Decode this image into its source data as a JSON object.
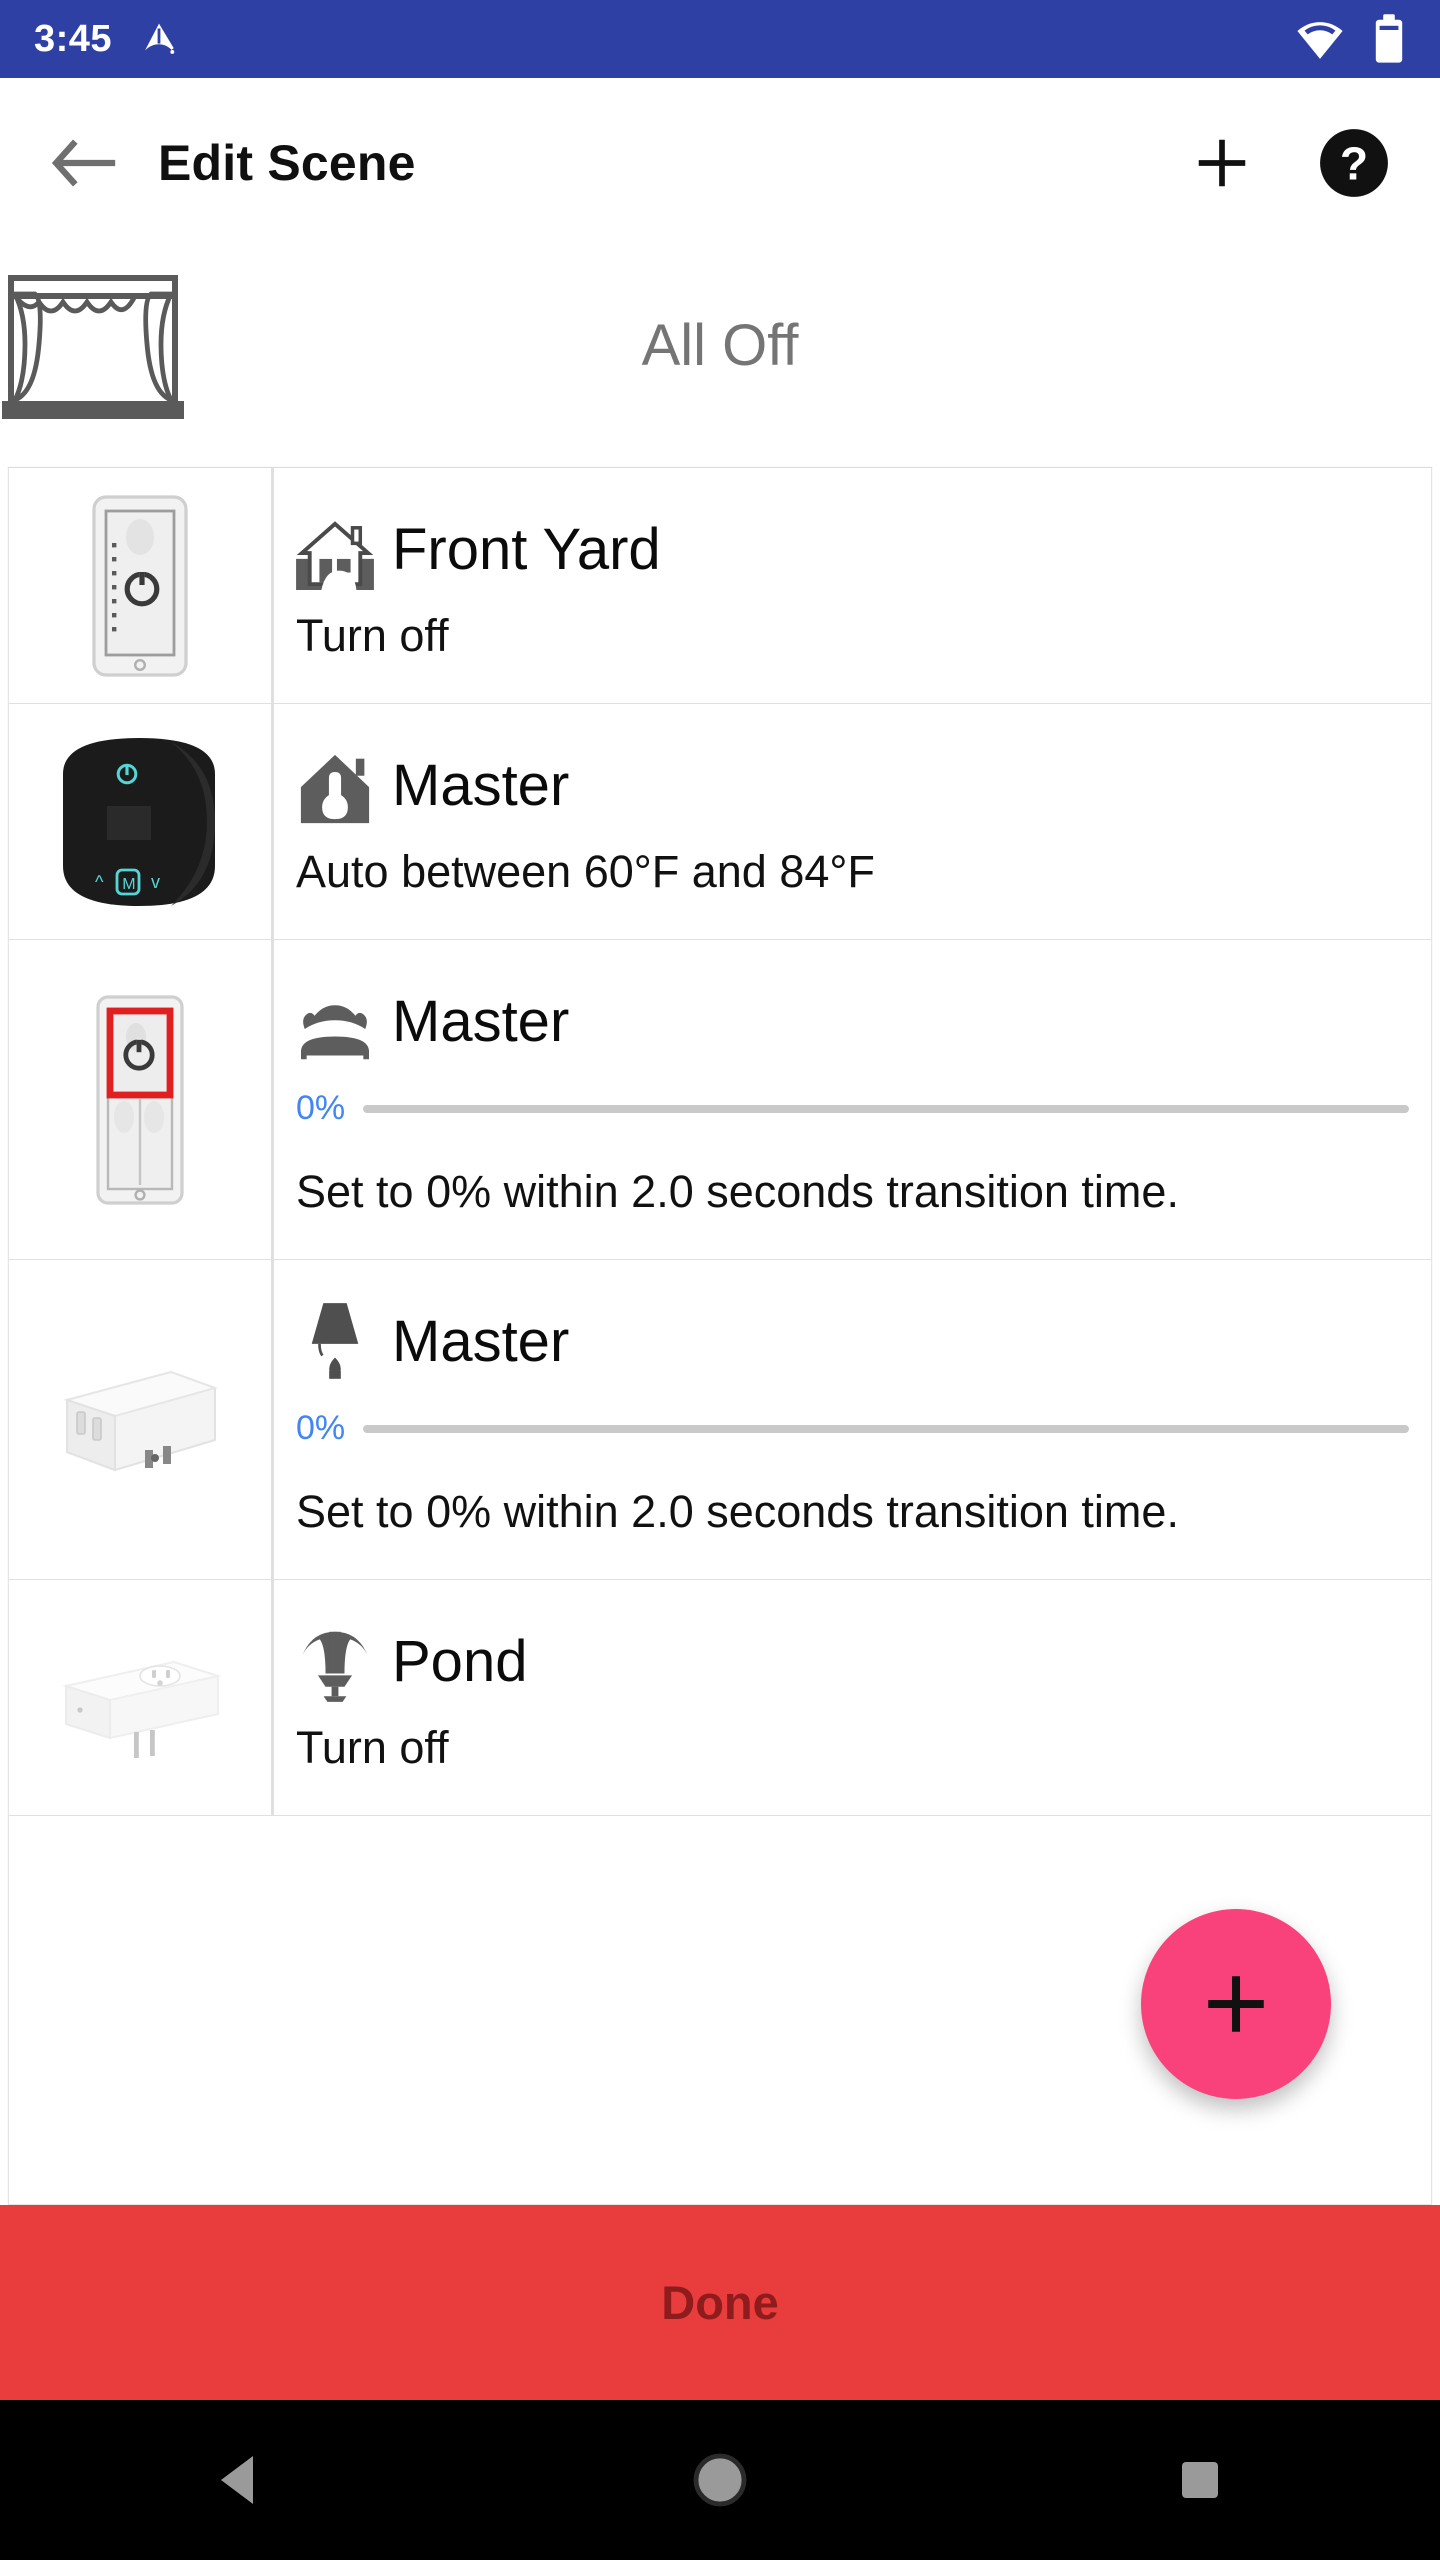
{
  "status_bar": {
    "time": "3:45",
    "icons": [
      "app-notification-icon",
      "wifi-icon",
      "battery-icon"
    ],
    "background": "#2F40A5"
  },
  "app_bar": {
    "back_icon": "back-arrow-icon",
    "title": "Edit Scene",
    "add_icon": "plus-icon",
    "help_icon": "help-circle-icon"
  },
  "scene": {
    "icon": "stage-curtain-icon",
    "name": "All Off"
  },
  "list": {
    "rows": [
      {
        "device_thumb": "wall-dimmer-switch",
        "category_icon": "house-front-yard-icon",
        "title": "Front Yard",
        "subtitle": "Turn off",
        "has_slider": false
      },
      {
        "device_thumb": "thermostat-device",
        "category_icon": "house-thermostat-icon",
        "title": "Master",
        "subtitle": "Auto between 60°F and 84°F",
        "has_slider": false
      },
      {
        "device_thumb": "wall-switch-highlighted",
        "category_icon": "bed-icon",
        "title": "Master",
        "subtitle": "Set to 0% within 2.0 seconds transition time.",
        "has_slider": true,
        "slider_percent": "0%",
        "slider_value": 0
      },
      {
        "device_thumb": "plug-in-lamp-module",
        "category_icon": "table-lamp-icon",
        "title": "Master",
        "subtitle": "Set to 0% within 2.0 seconds transition time.",
        "has_slider": true,
        "slider_percent": "0%",
        "slider_value": 0
      },
      {
        "device_thumb": "outdoor-plug-module",
        "category_icon": "fountain-icon",
        "title": "Pond",
        "subtitle": "Turn off",
        "has_slider": false
      }
    ]
  },
  "fab": {
    "icon": "plus-icon",
    "color": "#F9427B"
  },
  "bottom_bar": {
    "done_label": "Done",
    "background": "#E93C3C",
    "text_color": "#8F1C1C"
  },
  "nav_bar": {
    "back_icon": "nav-back-triangle-icon",
    "home_icon": "nav-home-circle-icon",
    "recents_icon": "nav-recents-square-icon"
  }
}
